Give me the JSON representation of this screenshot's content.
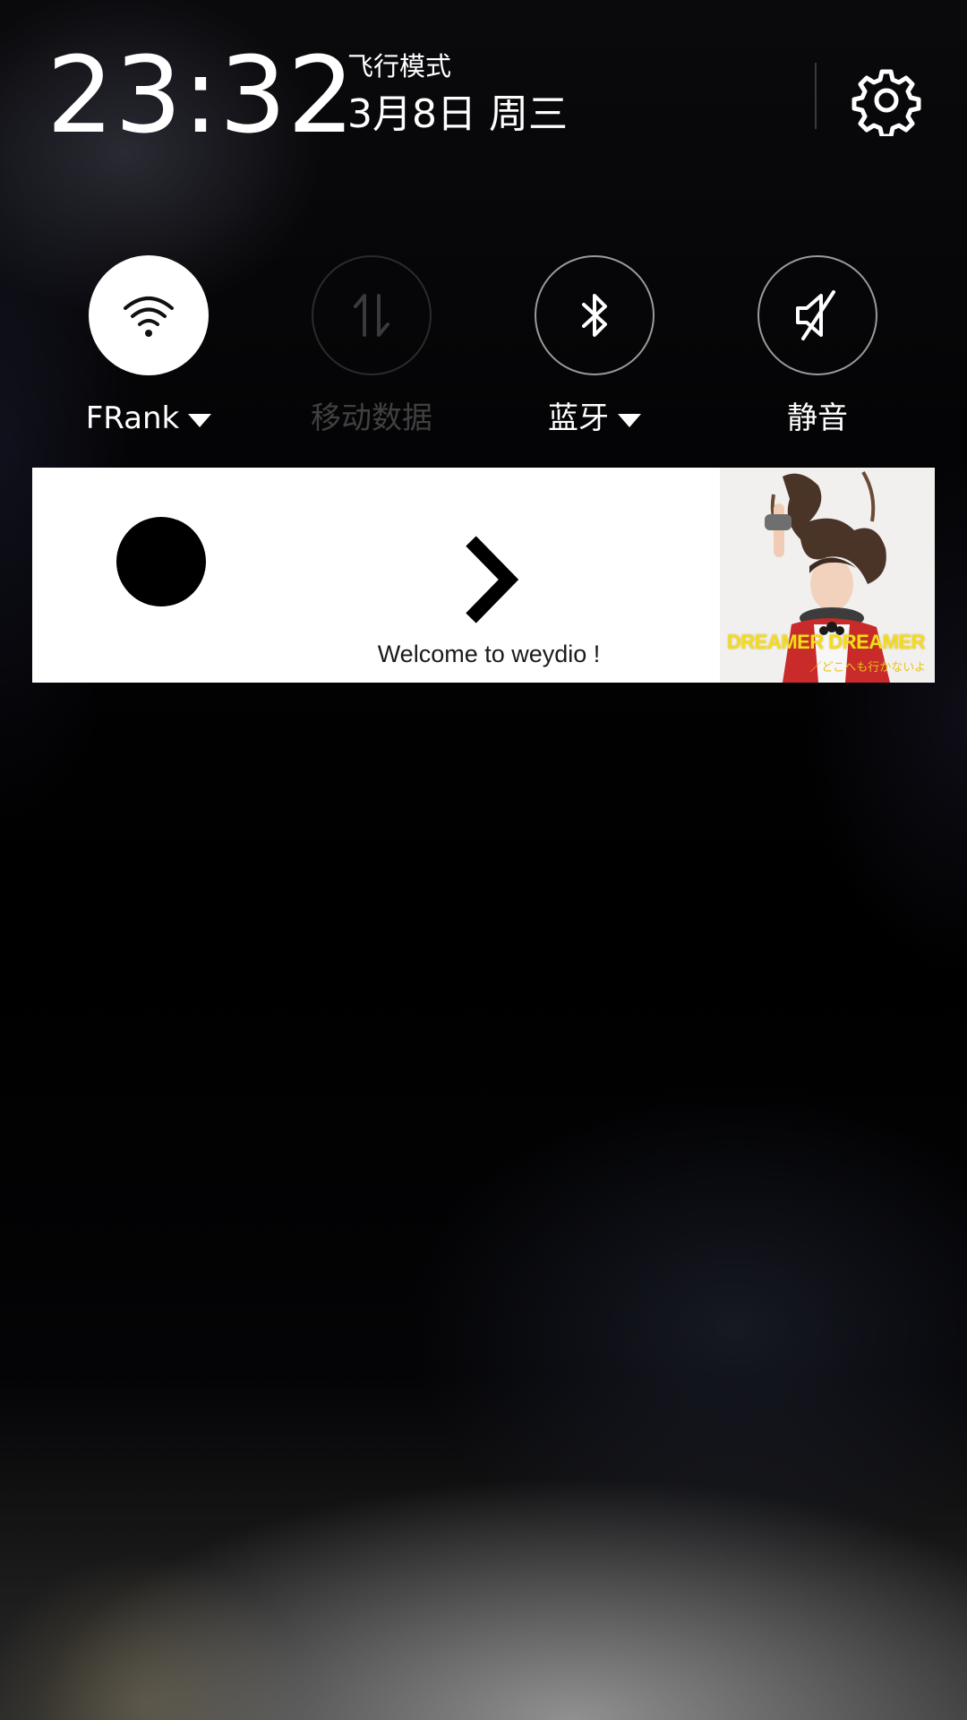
{
  "status": {
    "time": "23:32",
    "airplane_mode_label": "飞行模式",
    "date": "3月8日 周三",
    "settings_icon": "gear-icon"
  },
  "quick_tiles": [
    {
      "label": "FRank",
      "icon": "wifi-icon",
      "state": "on",
      "has_dropdown": true
    },
    {
      "label": "移动数据",
      "icon": "mobile-data-icon",
      "state": "disabled",
      "has_dropdown": false
    },
    {
      "label": "蓝牙",
      "icon": "bluetooth-icon",
      "state": "off",
      "has_dropdown": true
    },
    {
      "label": "静音",
      "icon": "mute-icon",
      "state": "off",
      "has_dropdown": false
    }
  ],
  "media_notification": {
    "message": "Welcome to weydio !",
    "play_icon": "record-dot-icon",
    "next_icon": "chevron-right-icon",
    "cover_title": "DREAMER DREAMER",
    "cover_subtitle": "／どこへも行かないよ"
  },
  "colors": {
    "tile_active": "#ffffff",
    "tile_border": "#9a9a9a",
    "tile_disabled": "#404040",
    "cover_title": "#f3dd1a"
  }
}
